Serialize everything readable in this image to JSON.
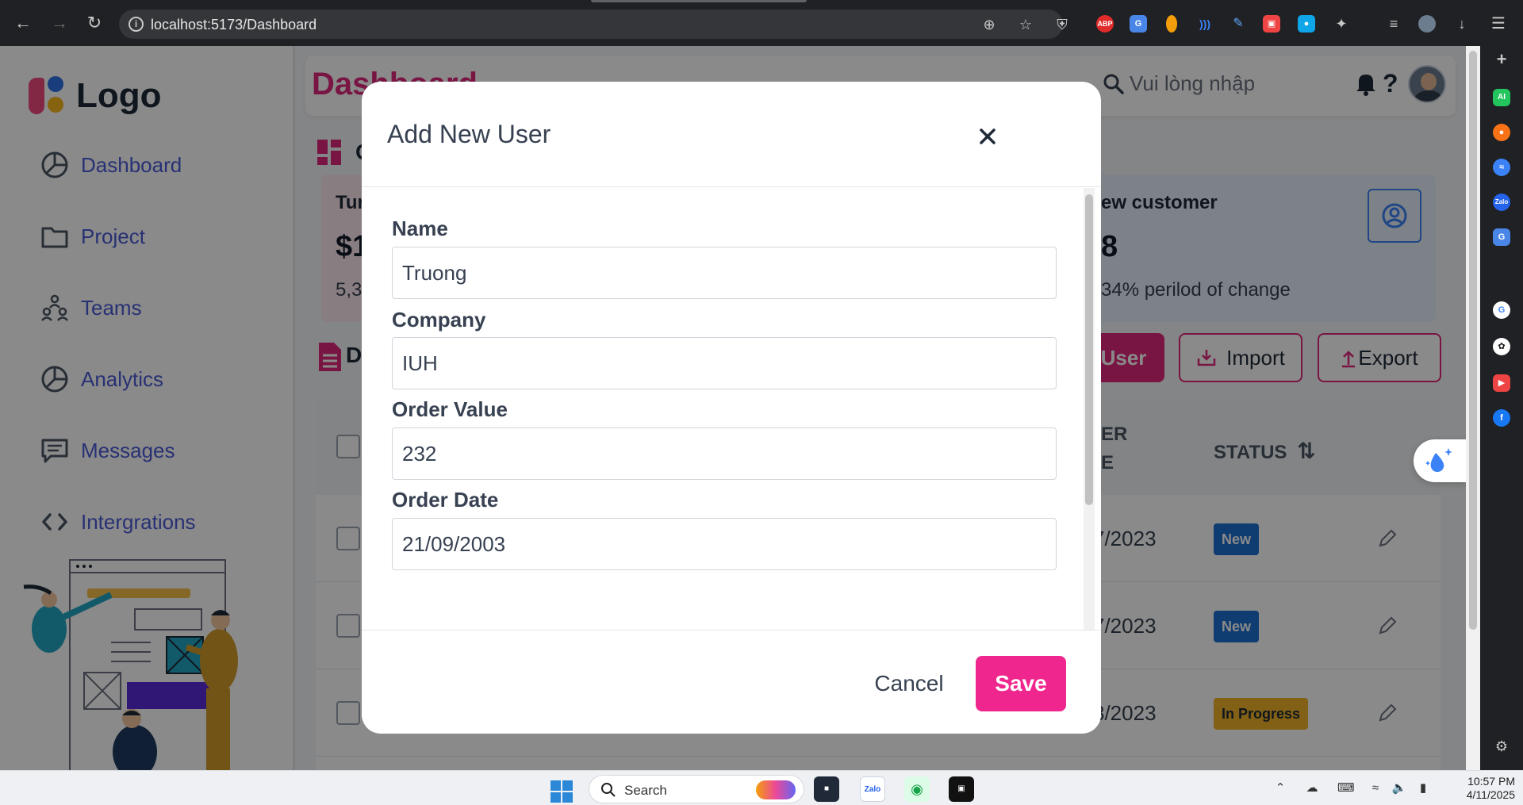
{
  "browser": {
    "url": "localhost:5173/Dashboard",
    "extensions": [
      {
        "name": "adblock-plus-icon",
        "label": "ABP",
        "color": "#e02b2b"
      },
      {
        "name": "google-translate-icon",
        "label": "G",
        "color": "#4a86e8"
      },
      {
        "name": "extension-orange-icon",
        "label": "",
        "color": "#f59e0b"
      },
      {
        "name": "extension-wave-icon",
        "label": ")))",
        "color": "#2563eb"
      },
      {
        "name": "eyedropper-icon",
        "label": "",
        "color": "#1f2937"
      },
      {
        "name": "extension-red-icon",
        "label": "",
        "color": "#ef4444"
      },
      {
        "name": "extension-drop-icon",
        "label": "",
        "color": "#0ea5e9"
      }
    ]
  },
  "side_panel": {
    "icons": [
      "add-icon",
      "ai-icon",
      "fire-icon",
      "messenger-icon",
      "zalo-icon",
      "translate-icon",
      "google-icon",
      "openai-icon",
      "youtube-icon",
      "facebook-icon",
      "settings-icon"
    ]
  },
  "app": {
    "logo_text": "Logo",
    "nav": [
      {
        "label": "Dashboard",
        "icon": "pie-chart-icon"
      },
      {
        "label": "Project",
        "icon": "folder-icon"
      },
      {
        "label": "Teams",
        "icon": "teams-icon"
      },
      {
        "label": "Analytics",
        "icon": "pie-chart-icon"
      },
      {
        "label": "Messages",
        "icon": "message-icon"
      },
      {
        "label": "Intergrations",
        "icon": "code-icon"
      }
    ],
    "header": {
      "title": "Dashboard",
      "search_placeholder": "Vui lòng nhập"
    },
    "overview": {
      "title_fragment": "O"
    },
    "cards": [
      {
        "title": "Tur",
        "value": "$1",
        "sub": "5,3"
      },
      {
        "title": "ew customer",
        "value": "8",
        "sub": "34% perilod of change"
      }
    ],
    "details": {
      "title_fragment": "D",
      "add_button": "User",
      "import_button": "Import",
      "export_button": "Export"
    },
    "table": {
      "header_date_line1": "ER",
      "header_date_line2": "E",
      "header_status": "STATUS",
      "rows": [
        {
          "date": "7/2023",
          "status": "New"
        },
        {
          "date": "7/2023",
          "status": "New"
        },
        {
          "date": "8/2023",
          "status": "In Progress"
        }
      ]
    }
  },
  "modal": {
    "title": "Add New User",
    "fields": [
      {
        "label": "Name",
        "value": "Truong"
      },
      {
        "label": "Company",
        "value": "IUH"
      },
      {
        "label": "Order Value",
        "value": "232"
      },
      {
        "label": "Order Date",
        "value": "21/09/2003"
      }
    ],
    "cancel_label": "Cancel",
    "save_label": "Save"
  },
  "taskbar": {
    "search_label": "Search",
    "time": "10:57 PM",
    "date": "4/11/2025"
  },
  "colors": {
    "accent_pink": "#e0287d",
    "save_pink": "#f0268f",
    "nav_blue": "#4b5bd6",
    "badge_new": "#1d6fd1",
    "badge_progress": "#f0b429"
  }
}
